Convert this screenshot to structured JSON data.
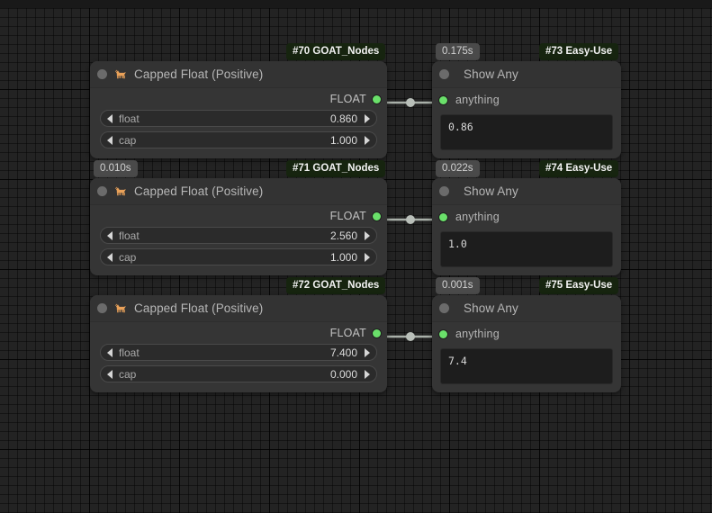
{
  "app": {
    "canvas_background": "#232323",
    "node_background": "#353535",
    "port_color": "#6ae06a",
    "badge_id_color": "#16240f",
    "badge_time_color": "#4a4a4a",
    "goat_icon_color": "#e9a159"
  },
  "nodes": [
    {
      "id": "#70 GOAT_Nodes",
      "time": "",
      "title": "Capped Float (Positive)",
      "icon": "goat-icon",
      "kind": "capped-float",
      "output_label": "FLOAT",
      "widgets": [
        {
          "name": "float",
          "value": "0.860"
        },
        {
          "name": "cap",
          "value": "1.000"
        }
      ]
    },
    {
      "id": "#71 GOAT_Nodes",
      "time": "0.010s",
      "title": "Capped Float (Positive)",
      "icon": "goat-icon",
      "kind": "capped-float",
      "output_label": "FLOAT",
      "widgets": [
        {
          "name": "float",
          "value": "2.560"
        },
        {
          "name": "cap",
          "value": "1.000"
        }
      ]
    },
    {
      "id": "#72 GOAT_Nodes",
      "time": "",
      "title": "Capped Float (Positive)",
      "icon": "goat-icon",
      "kind": "capped-float",
      "output_label": "FLOAT",
      "widgets": [
        {
          "name": "float",
          "value": "7.400"
        },
        {
          "name": "cap",
          "value": "0.000"
        }
      ]
    },
    {
      "id": "#73 Easy-Use",
      "time": "0.175s",
      "title": "Show Any",
      "kind": "show-any",
      "input_label": "anything",
      "output_text": "0.86"
    },
    {
      "id": "#74 Easy-Use",
      "time": "0.022s",
      "title": "Show Any",
      "kind": "show-any",
      "input_label": "anything",
      "output_text": "1.0"
    },
    {
      "id": "#75 Easy-Use",
      "time": "0.001s",
      "title": "Show Any",
      "kind": "show-any",
      "input_label": "anything",
      "output_text": "7.4"
    }
  ]
}
